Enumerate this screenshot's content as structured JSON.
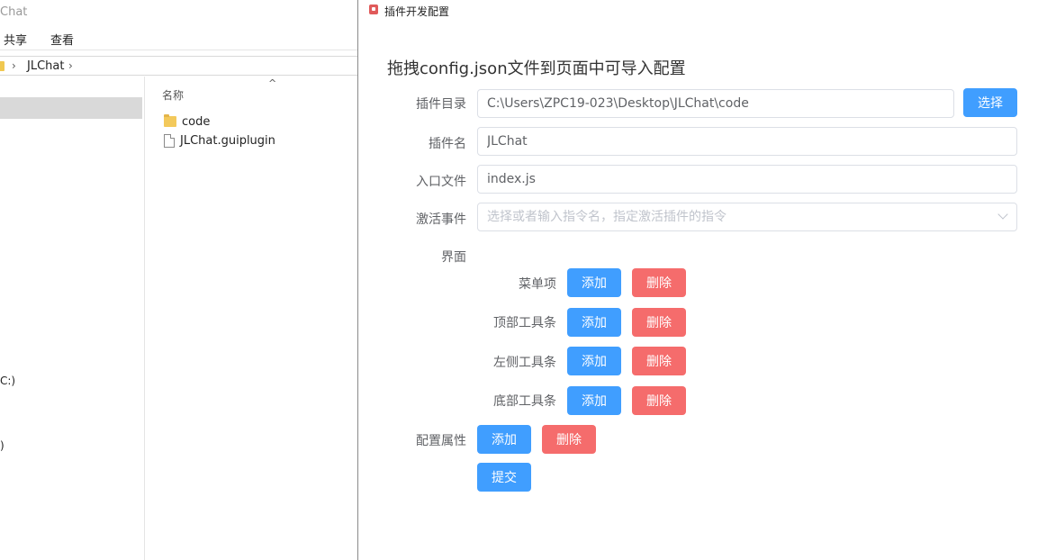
{
  "explorer": {
    "title_fragment": "Chat",
    "ribbon": [
      "共享",
      "查看"
    ],
    "breadcrumb": "JLChat",
    "column_name": "名称",
    "nav_fragments": [
      "C:)",
      ")"
    ],
    "files": [
      {
        "name": "code",
        "type": "folder"
      },
      {
        "name": "JLChat.guiplugin",
        "type": "file"
      }
    ]
  },
  "dialog": {
    "title": "插件开发配置",
    "heading": "拖拽config.json文件到页面中可导入配置",
    "fields": {
      "dir_label": "插件目录",
      "dir_value": "C:\\Users\\ZPC19-023\\Desktop\\JLChat\\code",
      "choose_button": "选择",
      "name_label": "插件名",
      "name_value": "JLChat",
      "entry_label": "入口文件",
      "entry_value": "index.js",
      "event_label": "激活事件",
      "event_placeholder": "选择或者输入指令名，指定激活插件的指令"
    },
    "ui_label": "界面",
    "ui_rows": [
      {
        "label": "菜单项",
        "add": "添加",
        "remove": "删除"
      },
      {
        "label": "顶部工具条",
        "add": "添加",
        "remove": "删除"
      },
      {
        "label": "左侧工具条",
        "add": "添加",
        "remove": "删除"
      },
      {
        "label": "底部工具条",
        "add": "添加",
        "remove": "删除"
      }
    ],
    "config_label": "配置属性",
    "config_add": "添加",
    "config_remove": "删除",
    "submit": "提交"
  },
  "colors": {
    "primary": "#409eff",
    "danger": "#f56c6c",
    "border": "#dcdfe6",
    "label": "#606266"
  }
}
